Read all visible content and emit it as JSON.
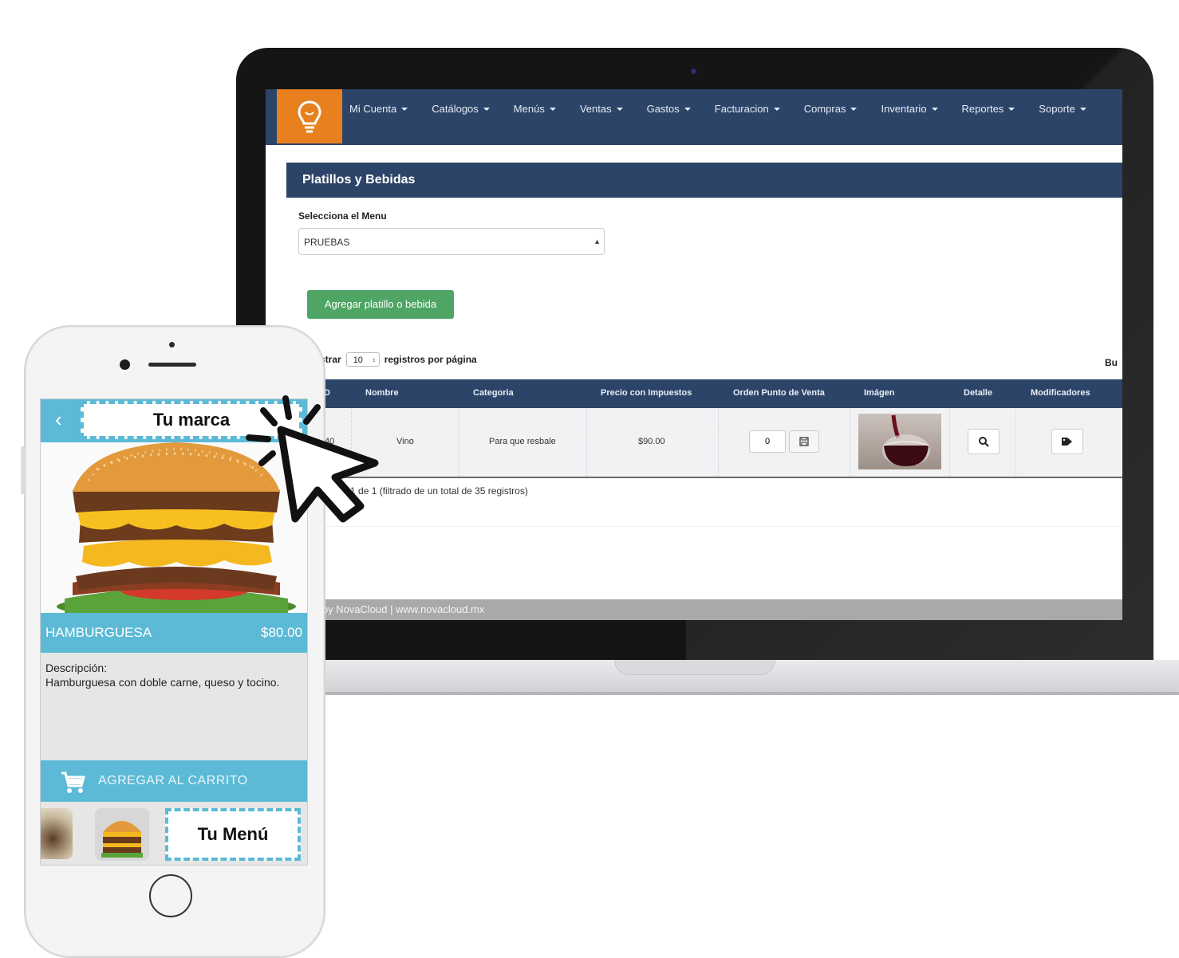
{
  "laptop_app": {
    "nav": {
      "items": [
        "Mi Cuenta",
        "Catálogos",
        "Menús",
        "Ventas",
        "Gastos",
        "Facturacion",
        "Compras",
        "Inventario",
        "Reportes",
        "Soporte"
      ]
    },
    "panel_title": "Platillos y Bebidas",
    "select_menu": {
      "label": "Selecciona el Menu",
      "value": "PRUEBAS"
    },
    "add_button": "Agregar platillo o bebida",
    "length_control": {
      "prefix": "strar",
      "value": "10",
      "suffix": "registros por página"
    },
    "search_label": "Bu",
    "table": {
      "columns": [
        "ID",
        "Nombre",
        "Categoria",
        "Precio con Impuestos",
        "Orden Punto de Venta",
        "Imágen",
        "Detalle",
        "Modificadores"
      ],
      "rows": [
        {
          "id": "40",
          "name": "Vino",
          "category": "Para que resbale",
          "price": "$90.00",
          "order": "0"
        }
      ]
    },
    "info_text": "gina 1 de 1 (filtrado de un total de 35 registros)",
    "footer": "d by NovaCloud | www.novacloud.mx"
  },
  "phone_app": {
    "brand": "Tu marca",
    "product_name": "HAMBURGUESA",
    "product_price": "$80.00",
    "description_label": "Descripción:",
    "description": "Hamburguesa con doble carne, queso y tocino.",
    "cart_button": "AGREGAR AL CARRITO",
    "menu_label": "Tu Menú"
  },
  "colors": {
    "nav_blue": "#2c4468",
    "logo_orange": "#e8801f",
    "add_green": "#4fa564",
    "phone_accent": "#5cbad6"
  },
  "icons": [
    "lightbulb-icon",
    "save-icon",
    "search-icon",
    "tag-icon",
    "back-chevron-icon",
    "cart-icon",
    "cursor-pointer-icon"
  ]
}
